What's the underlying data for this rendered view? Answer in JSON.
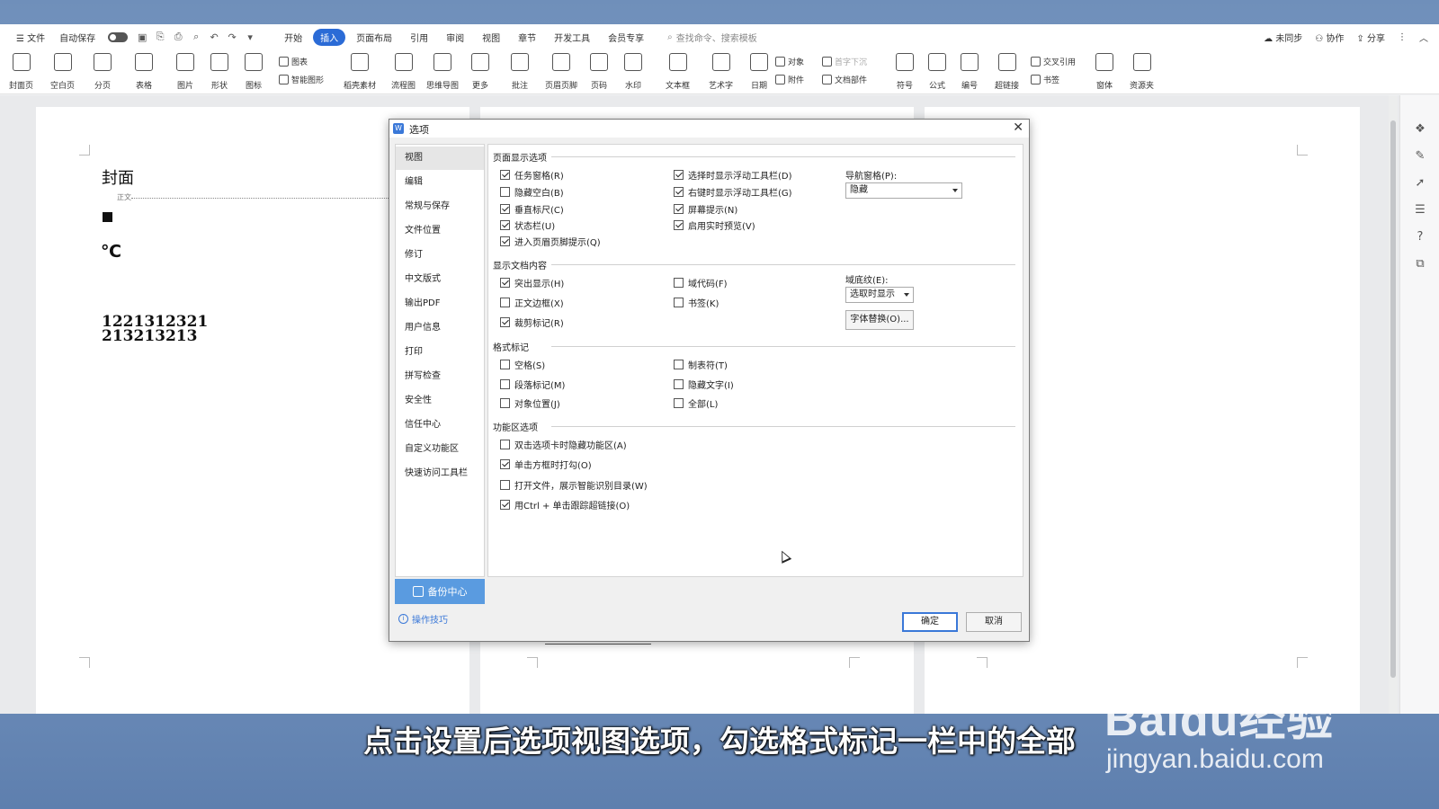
{
  "menubar": {
    "file": "文件",
    "autosave": "自动保存",
    "tabs": [
      "开始",
      "插入",
      "页面布局",
      "引用",
      "审阅",
      "视图",
      "章节",
      "开发工具",
      "会员专享"
    ],
    "active_tab": "插入",
    "search_placeholder": "查找命令、搜索模板",
    "sync": "未同步",
    "collab": "协作",
    "share": "分享"
  },
  "ribbon": {
    "big": [
      {
        "label": "封面页",
        "icon": "cover-page-icon"
      },
      {
        "label": "空白页",
        "icon": "blank-page-icon"
      },
      {
        "label": "分页",
        "icon": "page-break-icon"
      },
      {
        "label": "表格",
        "icon": "table-icon"
      },
      {
        "label": "图片",
        "icon": "picture-icon"
      },
      {
        "label": "形状",
        "icon": "shape-icon"
      },
      {
        "label": "图标",
        "icon": "icons-icon"
      },
      {
        "label": "稻壳素材",
        "icon": "material-icon"
      },
      {
        "label": "流程图",
        "icon": "flowchart-icon"
      },
      {
        "label": "思维导图",
        "icon": "mindmap-icon"
      },
      {
        "label": "更多",
        "icon": "more-icon"
      },
      {
        "label": "批注",
        "icon": "comment-icon"
      },
      {
        "label": "页眉页脚",
        "icon": "header-footer-icon"
      },
      {
        "label": "页码",
        "icon": "page-number-icon"
      },
      {
        "label": "水印",
        "icon": "watermark-icon"
      },
      {
        "label": "文本框",
        "icon": "textbox-icon"
      },
      {
        "label": "艺术字",
        "icon": "wordart-icon"
      },
      {
        "label": "日期",
        "icon": "date-icon"
      },
      {
        "label": "符号",
        "icon": "symbol-icon"
      },
      {
        "label": "公式",
        "icon": "formula-icon"
      },
      {
        "label": "编号",
        "icon": "numbering-icon"
      },
      {
        "label": "超链接",
        "icon": "hyperlink-icon"
      },
      {
        "label": "窗体",
        "icon": "form-icon"
      },
      {
        "label": "资源夹",
        "icon": "resource-icon"
      }
    ],
    "chart": "图表",
    "smart_shape": "智能图形",
    "object": "对象",
    "attachment": "附件",
    "drop_cap": "首字下沉",
    "doc_parts": "文档部件",
    "cross_ref": "交叉引用",
    "bookmark": "书签"
  },
  "document": {
    "title": "封面",
    "style_label": "正文",
    "symbol": "℃",
    "line1": "1221312321",
    "line2": "213213213"
  },
  "dialog": {
    "title": "选项",
    "nav": [
      "视图",
      "编辑",
      "常规与保存",
      "文件位置",
      "修订",
      "中文版式",
      "输出PDF",
      "用户信息",
      "打印",
      "拼写检查",
      "安全性",
      "信任中心",
      "自定义功能区",
      "快速访问工具栏"
    ],
    "active_nav": "视图",
    "backup": "备份中心",
    "tips": "操作技巧",
    "sections": {
      "page_display": "页面显示选项",
      "doc_content": "显示文档内容",
      "format_marks": "格式标记",
      "ribbon_options": "功能区选项"
    },
    "page_display_left": [
      {
        "label": "任务窗格(R)",
        "checked": true
      },
      {
        "label": "隐藏空白(B)",
        "checked": false
      },
      {
        "label": "垂直标尺(C)",
        "checked": true
      },
      {
        "label": "状态栏(U)",
        "checked": true
      },
      {
        "label": "进入页眉页脚提示(Q)",
        "checked": true
      }
    ],
    "page_display_right": [
      {
        "label": "选择时显示浮动工具栏(D)",
        "checked": true
      },
      {
        "label": "右键时显示浮动工具栏(G)",
        "checked": true
      },
      {
        "label": "屏幕提示(N)",
        "checked": true
      },
      {
        "label": "启用实时预览(V)",
        "checked": true
      }
    ],
    "nav_pane_label": "导航窗格(P):",
    "nav_pane_value": "隐藏",
    "doc_content_left": [
      {
        "label": "突出显示(H)",
        "checked": true
      },
      {
        "label": "正文边框(X)",
        "checked": false
      },
      {
        "label": "裁剪标记(R)",
        "checked": true
      }
    ],
    "doc_content_right": [
      {
        "label": "域代码(F)",
        "checked": false
      },
      {
        "label": "书签(K)",
        "checked": false
      }
    ],
    "field_shading_label": "域底纹(E):",
    "field_shading_value": "选取时显示",
    "font_sub_button": "字体替换(O)...",
    "format_marks_left": [
      {
        "label": "空格(S)",
        "checked": false
      },
      {
        "label": "段落标记(M)",
        "checked": false
      },
      {
        "label": "对象位置(J)",
        "checked": false
      }
    ],
    "format_marks_right": [
      {
        "label": "制表符(T)",
        "checked": false
      },
      {
        "label": "隐藏文字(I)",
        "checked": false
      },
      {
        "label": "全部(L)",
        "checked": false
      }
    ],
    "ribbon_opts": [
      {
        "label": "双击选项卡时隐藏功能区(A)",
        "checked": false
      },
      {
        "label": "单击方框时打勾(O)",
        "checked": true
      },
      {
        "label": "打开文件，展示智能识别目录(W)",
        "checked": false
      },
      {
        "label": "用Ctrl + 单击跟踪超链接(O)",
        "checked": true
      }
    ],
    "ok": "确定",
    "cancel": "取消"
  },
  "subtitle": "点击设置后选项视图选项，勾选格式标记一栏中的全部",
  "watermark": {
    "logo": "Baidu经验",
    "site": "jingyan.baidu.com"
  },
  "colors": {
    "accent": "#2b6bd6",
    "backup_bg": "#5a9be0",
    "link": "#3a78d8"
  }
}
